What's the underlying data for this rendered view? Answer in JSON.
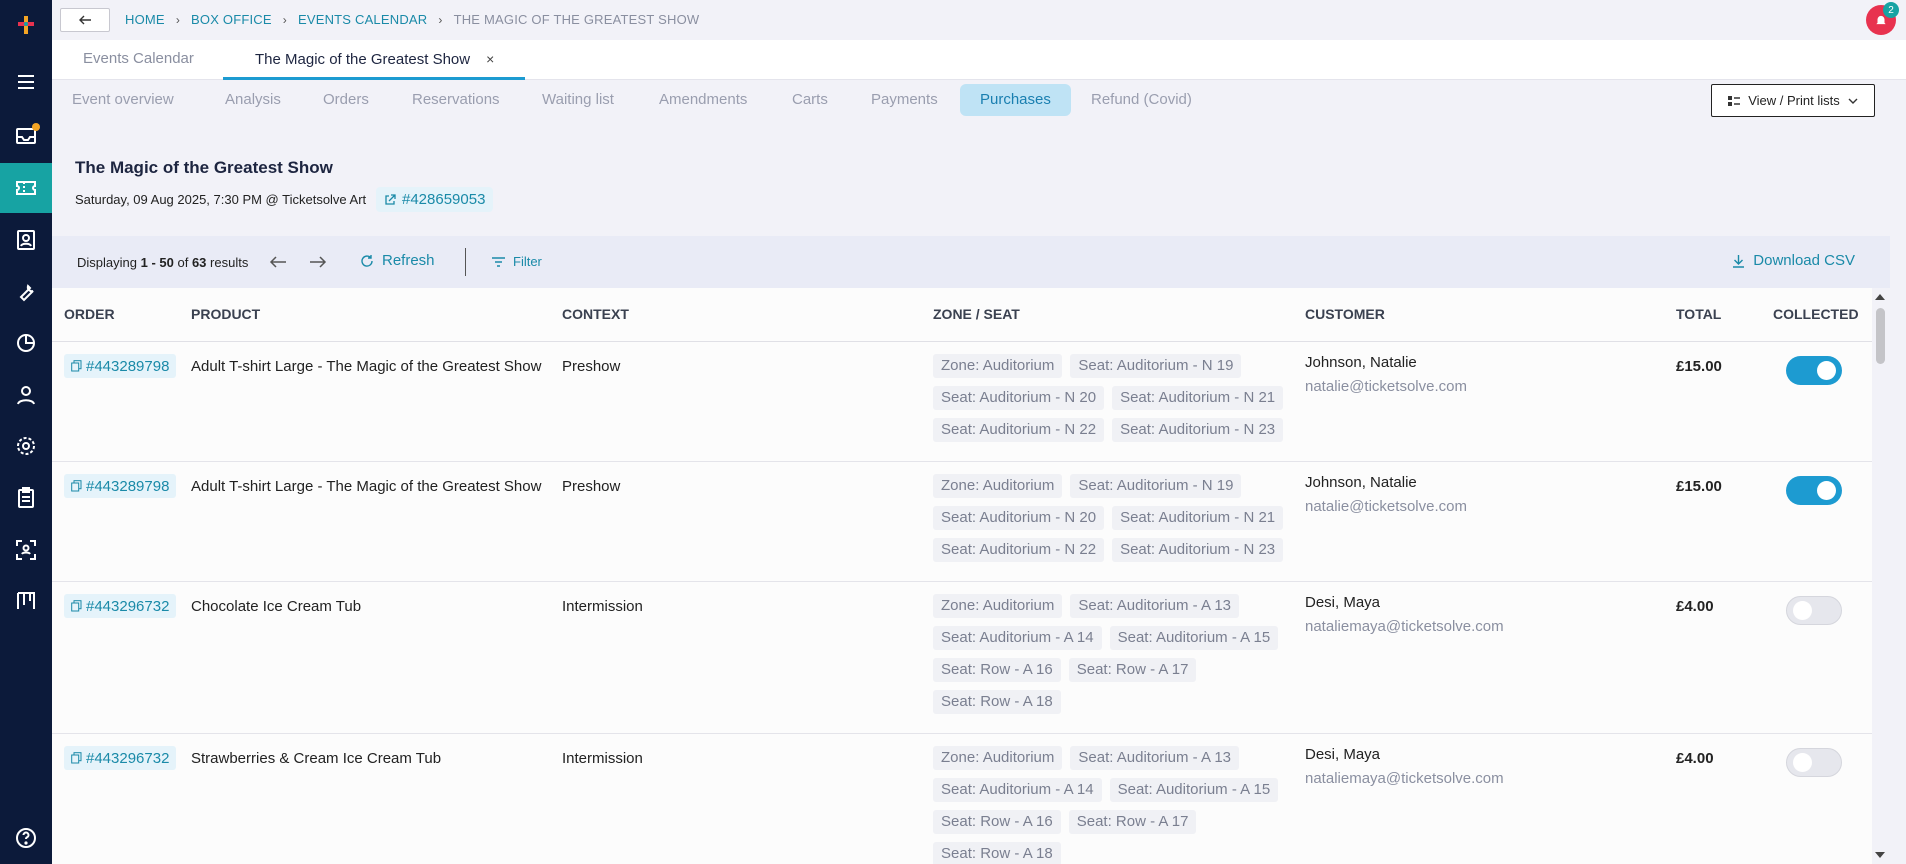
{
  "breadcrumb": [
    "HOME",
    "BOX OFFICE",
    "EVENTS CALENDAR",
    "THE MAGIC OF THE GREATEST SHOW"
  ],
  "notifications": {
    "count": "2"
  },
  "doc_tabs": [
    {
      "label": "Events Calendar"
    },
    {
      "label": "The Magic of the Greatest Show",
      "close": "×"
    }
  ],
  "sub_tabs": [
    "Event overview",
    "Analysis",
    "Orders",
    "Reservations",
    "Waiting list",
    "Amendments",
    "Carts",
    "Payments",
    "Purchases",
    "Refund (Covid)"
  ],
  "active_sub_tab": "Purchases",
  "print_button": "View / Print lists",
  "event": {
    "title": "The Magic of the Greatest Show",
    "meta": "Saturday, 09 Aug 2025, 7:30 PM @ Ticketsolve Art",
    "id": "#428659053"
  },
  "results": {
    "prefix": "Displaying",
    "range": "1 - 50",
    "of": "of",
    "total": "63",
    "suffix": "results",
    "refresh": "Refresh",
    "filter": "Filter",
    "download": "Download CSV"
  },
  "columns": [
    "ORDER",
    "PRODUCT",
    "CONTEXT",
    "ZONE / SEAT",
    "CUSTOMER",
    "TOTAL",
    "COLLECTED"
  ],
  "rows": [
    {
      "order": "#443289798",
      "product": "Adult T-shirt Large - The Magic of the Greatest Show",
      "context": "Preshow",
      "seats": [
        "Zone: Auditorium",
        "Seat: Auditorium - N 19",
        "Seat: Auditorium - N 20",
        "Seat: Auditorium - N 21",
        "Seat: Auditorium - N 22",
        "Seat: Auditorium - N 23"
      ],
      "customer": "Johnson, Natalie",
      "email": "natalie@ticketsolve.com",
      "total": "£15.00",
      "collected": true
    },
    {
      "order": "#443289798",
      "product": "Adult T-shirt Large - The Magic of the Greatest Show",
      "context": "Preshow",
      "seats": [
        "Zone: Auditorium",
        "Seat: Auditorium - N 19",
        "Seat: Auditorium - N 20",
        "Seat: Auditorium - N 21",
        "Seat: Auditorium - N 22",
        "Seat: Auditorium - N 23"
      ],
      "customer": "Johnson, Natalie",
      "email": "natalie@ticketsolve.com",
      "total": "£15.00",
      "collected": true
    },
    {
      "order": "#443296732",
      "product": "Chocolate Ice Cream Tub",
      "context": "Intermission",
      "seats": [
        "Zone: Auditorium",
        "Seat: Auditorium - A 13",
        "Seat: Auditorium - A 14",
        "Seat: Auditorium - A 15",
        "Seat: Row - A 16",
        "Seat: Row - A 17",
        "Seat: Row - A 18"
      ],
      "customer": "Desi, Maya",
      "email": "nataliemaya@ticketsolve.com",
      "total": "£4.00",
      "collected": false
    },
    {
      "order": "#443296732",
      "product": "Strawberries & Cream Ice Cream Tub",
      "context": "Intermission",
      "seats": [
        "Zone: Auditorium",
        "Seat: Auditorium - A 13",
        "Seat: Auditorium - A 14",
        "Seat: Auditorium - A 15",
        "Seat: Row - A 16",
        "Seat: Row - A 17",
        "Seat: Row - A 18"
      ],
      "customer": "Desi, Maya",
      "email": "nataliemaya@ticketsolve.com",
      "total": "£4.00",
      "collected": false
    }
  ],
  "colors": {
    "sidebar": "#0c1a3a",
    "accent": "#1d9bd1",
    "active_nav": "#17a3a3",
    "link": "#1a8aa8"
  }
}
